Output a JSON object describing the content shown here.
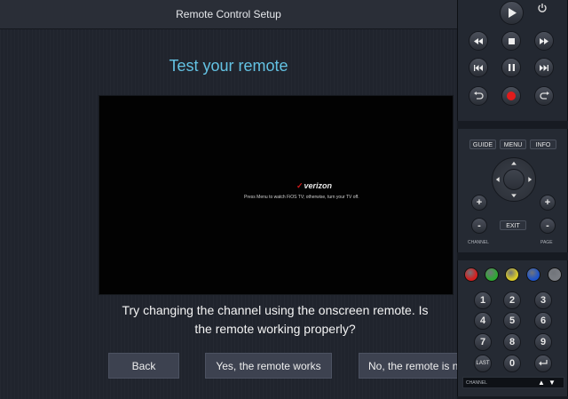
{
  "dialog": {
    "title": "Remote Control Setup",
    "heading": "Test your remote",
    "tv_screen": {
      "brand": "verizon",
      "message": "Press Menu to watch FiOS TV; otherwise, turn your TV off."
    },
    "instruction_line1": "Try changing the channel using the onscreen remote. Is",
    "instruction_line2": "the remote working properly?",
    "buttons": {
      "back": "Back",
      "yes": "Yes, the remote works",
      "no": "No, the remote is n"
    }
  },
  "remote": {
    "guide": "GUIDE",
    "menu": "MENU",
    "info": "INFO",
    "exit": "EXIT",
    "plus": "+",
    "minus": "-",
    "channel_label": "CHANNEL",
    "page_label": "PAGE",
    "last": "LAST",
    "numbers": [
      "1",
      "2",
      "3",
      "4",
      "5",
      "6",
      "7",
      "8",
      "9",
      "0"
    ],
    "bottom_channel_label": "CHANNEL",
    "color_keys": [
      "#d32020",
      "#2fa834",
      "#d8c92a",
      "#1f55c9",
      "#7a7d83"
    ]
  }
}
